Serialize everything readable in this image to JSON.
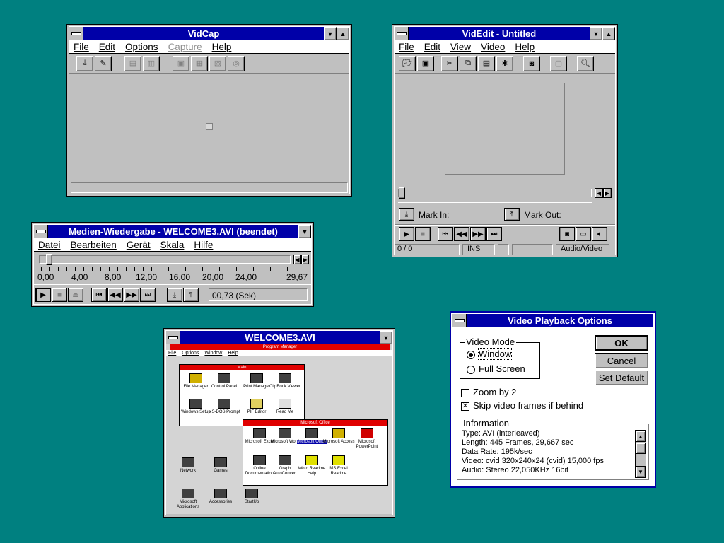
{
  "vidcap": {
    "title": "VidCap",
    "menu": [
      "File",
      "Edit",
      "Options",
      "Capture",
      "Help"
    ]
  },
  "videdit": {
    "title": "VidEdit - Untitled",
    "menu": [
      "File",
      "Edit",
      "View",
      "Video",
      "Help"
    ],
    "mark_in": "Mark In:",
    "mark_out": "Mark Out:",
    "status": {
      "position": "0 / 0",
      "mode": "INS",
      "type": "Audio/Video"
    }
  },
  "media": {
    "title": "Medien-Wiedergabe - WELCOME3.AVI (beendet)",
    "menu": [
      "Datei",
      "Bearbeiten",
      "Gerät",
      "Skala",
      "Hilfe"
    ],
    "scale": [
      "0,00",
      "4,00",
      "8,00",
      "12,00",
      "16,00",
      "20,00",
      "24,00",
      "29,67"
    ],
    "position": "00,73 (Sek)",
    "progress": 0.025
  },
  "welcome": {
    "title": "WELCOME3.AVI",
    "pm_title": "Program Manager",
    "pm_menu": [
      "File",
      "Options",
      "Window",
      "Help"
    ],
    "main_title": "Main",
    "main_icons": [
      "File Manager",
      "Control Panel",
      "Print Manager",
      "ClipBook Viewer",
      "Windows Setup",
      "MS-DOS Prompt",
      "PIF Editor",
      "Read Me"
    ],
    "office_title": "Microsoft Office",
    "office_icons": [
      "Microsoft Excel",
      "Microsoft Word",
      "Microsoft Office",
      "Microsoft Access",
      "Microsoft PowerPoint",
      "Online Documentation",
      "Graph AutoConvert",
      "Word Readme Help",
      "MS Excel Readme"
    ],
    "groups": [
      "Network",
      "Games",
      "Microsoft Applications",
      "Accessories",
      "StartUp"
    ]
  },
  "options": {
    "title": "Video Playback Options",
    "video_mode": "Video Mode",
    "window": "Window",
    "full_screen": "Full Screen",
    "ok": "OK",
    "cancel": "Cancel",
    "set_default": "Set Default",
    "zoom": "Zoom by 2",
    "skip": "Skip video frames if behind",
    "info_label": "Information",
    "info": [
      "Type: AVI (interleaved)",
      "Length: 445 Frames, 29,667 sec",
      "Data Rate: 195k/sec",
      "Video: cvid 320x240x24 (cvid) 15,000 fps",
      "Audio: Stereo 22,050KHz 16bit"
    ]
  },
  "colors": {
    "desktop": "#008080",
    "active_title": "#0000a8",
    "pm_title": "#e00000"
  }
}
